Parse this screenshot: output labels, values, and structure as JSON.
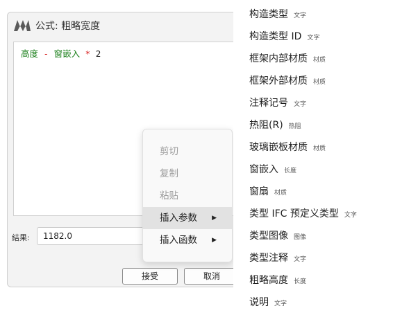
{
  "dialog": {
    "title": "公式: 粗略宽度",
    "formula": {
      "tokens": [
        {
          "text": "高度",
          "kind": "id"
        },
        {
          "text": "-",
          "kind": "op"
        },
        {
          "text": "窗嵌入",
          "kind": "id"
        },
        {
          "text": "*",
          "kind": "op"
        },
        {
          "text": "2",
          "kind": "num"
        }
      ]
    },
    "result_label": "結果:",
    "result_value": "1182.0",
    "accept_label": "接受",
    "cancel_label": "取消"
  },
  "context_menu": {
    "items": [
      {
        "label": "剪切",
        "enabled": false
      },
      {
        "label": "复制",
        "enabled": false
      },
      {
        "label": "粘贴",
        "enabled": false
      },
      {
        "label": "插入参数",
        "enabled": true,
        "submenu": true,
        "active": true
      },
      {
        "label": "插入函数",
        "enabled": true,
        "submenu": true
      }
    ]
  },
  "parameters": [
    {
      "name": "构造类型",
      "type": "文字"
    },
    {
      "name": "构造类型 ID",
      "type": "文字"
    },
    {
      "name": "框架内部材质",
      "type": "材质"
    },
    {
      "name": "框架外部材质",
      "type": "材质"
    },
    {
      "name": "注释记号",
      "type": "文字"
    },
    {
      "name": "热阻(R)",
      "type": "热阻"
    },
    {
      "name": "玻璃嵌板材质",
      "type": "材质"
    },
    {
      "name": "窗嵌入",
      "type": "长度"
    },
    {
      "name": "窗扇",
      "type": "材质"
    },
    {
      "name": "类型 IFC 预定义类型",
      "type": "文字"
    },
    {
      "name": "类型图像",
      "type": "图像"
    },
    {
      "name": "类型注释",
      "type": "文字"
    },
    {
      "name": "粗略高度",
      "type": "长度"
    },
    {
      "name": "说明",
      "type": "文字"
    }
  ],
  "icons": {
    "logo": "app-logo-icon",
    "submenu_arrow": "chevron-right-icon"
  },
  "colors": {
    "formula_identifier": "#1a7f1a",
    "formula_operator": "#d81b1b",
    "menu_highlight": "#e2e2e2"
  }
}
